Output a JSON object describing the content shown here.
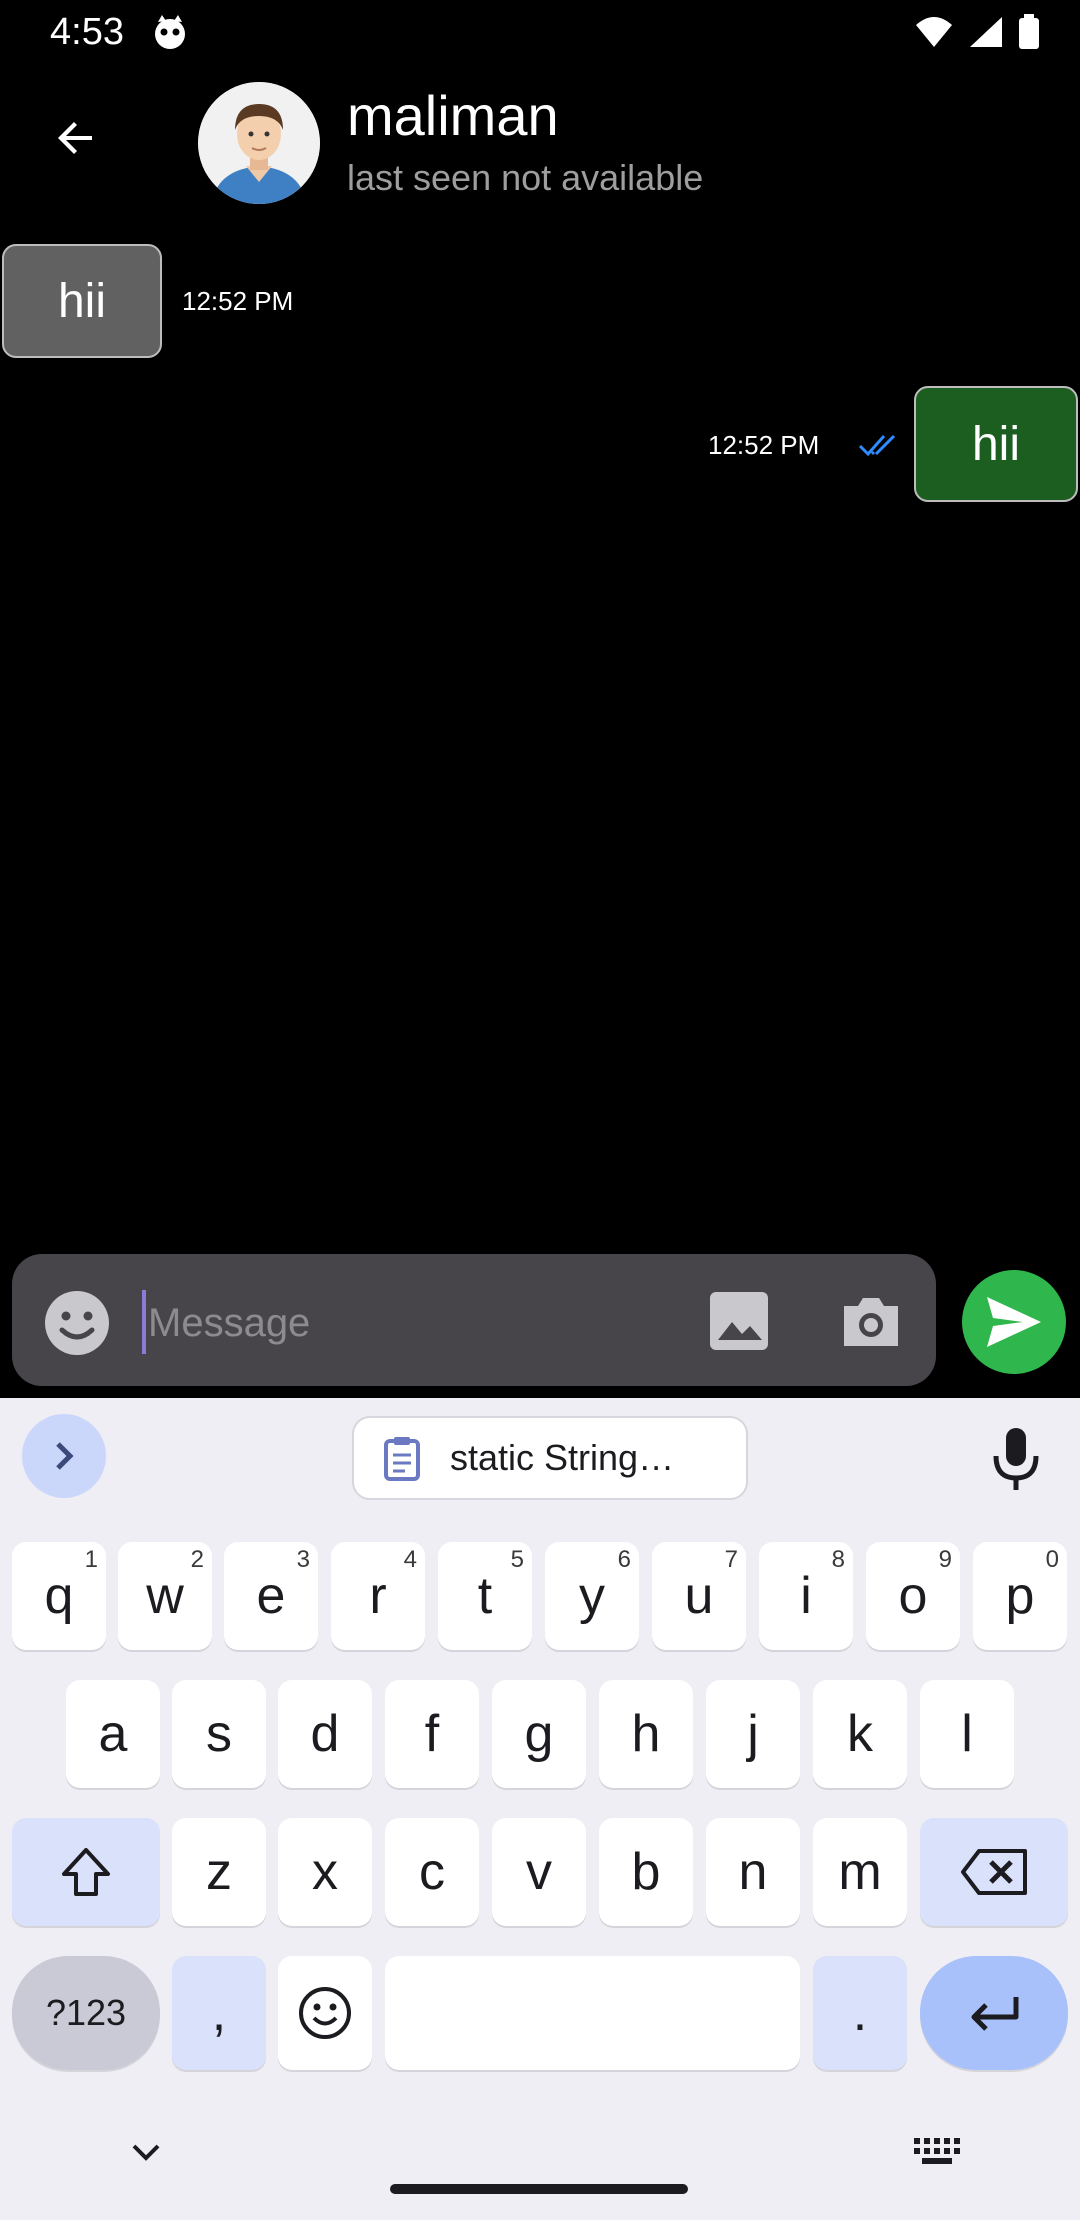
{
  "status_bar": {
    "time": "4:53"
  },
  "header": {
    "back_label": "Back",
    "contact_name": "maliman",
    "contact_status": "last seen not available"
  },
  "messages": [
    {
      "direction": "incoming",
      "text": "hii",
      "time": "12:52 PM"
    },
    {
      "direction": "outgoing",
      "text": "hii",
      "time": "12:52 PM",
      "read": true
    }
  ],
  "composer": {
    "placeholder": "Message",
    "value": ""
  },
  "keyboard": {
    "clipboard_suggestion": "static String…",
    "rows": [
      [
        {
          "k": "q",
          "h": "1"
        },
        {
          "k": "w",
          "h": "2"
        },
        {
          "k": "e",
          "h": "3"
        },
        {
          "k": "r",
          "h": "4"
        },
        {
          "k": "t",
          "h": "5"
        },
        {
          "k": "y",
          "h": "6"
        },
        {
          "k": "u",
          "h": "7"
        },
        {
          "k": "i",
          "h": "8"
        },
        {
          "k": "o",
          "h": "9"
        },
        {
          "k": "p",
          "h": "0"
        }
      ],
      [
        "a",
        "s",
        "d",
        "f",
        "g",
        "h",
        "j",
        "k",
        "l"
      ],
      [
        "z",
        "x",
        "c",
        "v",
        "b",
        "n",
        "m"
      ]
    ],
    "symbols_label": "?123",
    "comma": ",",
    "period": "."
  },
  "colors": {
    "incoming_bubble": "#616161",
    "outgoing_bubble": "#1b5e20",
    "send_button": "#2fb64c",
    "read_tick": "#2f8cff"
  }
}
